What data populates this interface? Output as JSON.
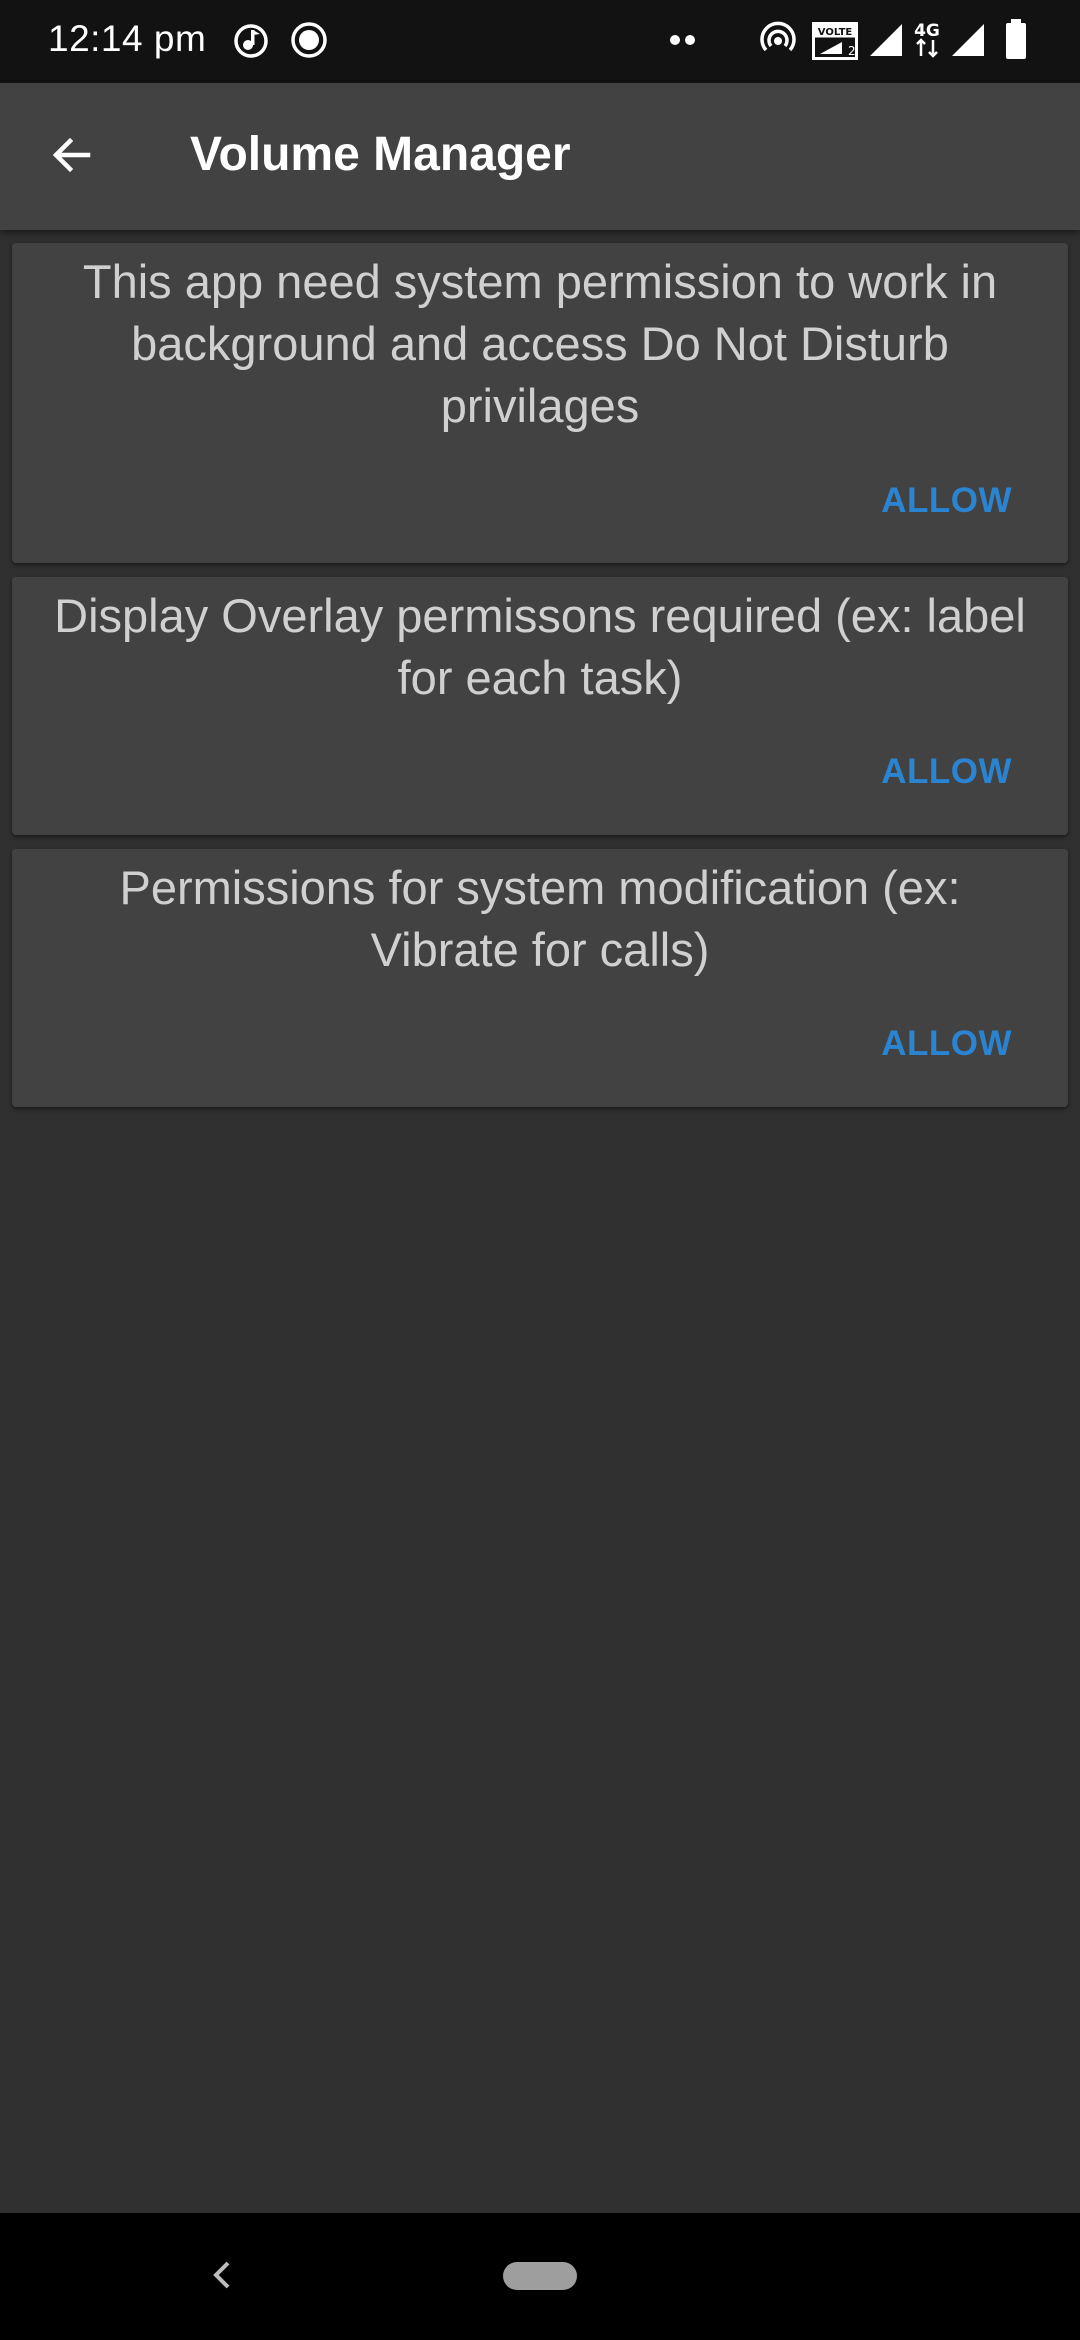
{
  "status_bar": {
    "time": "12:14 pm",
    "icons": [
      "music-sync-icon",
      "record-icon",
      "more-dots-icon",
      "hotspot-icon",
      "volte-icon",
      "signal-icon",
      "4g-icon",
      "signal-icon",
      "battery-icon"
    ],
    "volte_label": "VOLTE",
    "network_label": "4G"
  },
  "app_bar": {
    "title": "Volume Manager",
    "back_icon": "arrow-left-icon"
  },
  "cards": [
    {
      "text": "This app need system permission to work in background and access Do Not Disturb privilages",
      "action": "ALLOW"
    },
    {
      "text": "Display Overlay permissons required (ex: label for each task)",
      "action": "ALLOW"
    },
    {
      "text": "Permissions for system modification (ex: Vibrate for calls)",
      "action": "ALLOW"
    }
  ],
  "nav_bar": {
    "back_icon": "chevron-left-icon",
    "home_icon": "home-pill-icon"
  },
  "colors": {
    "background": "#303030",
    "app_bar": "#424242",
    "card": "#424242",
    "accent": "#2a84d2",
    "text": "#d0d0d0"
  }
}
